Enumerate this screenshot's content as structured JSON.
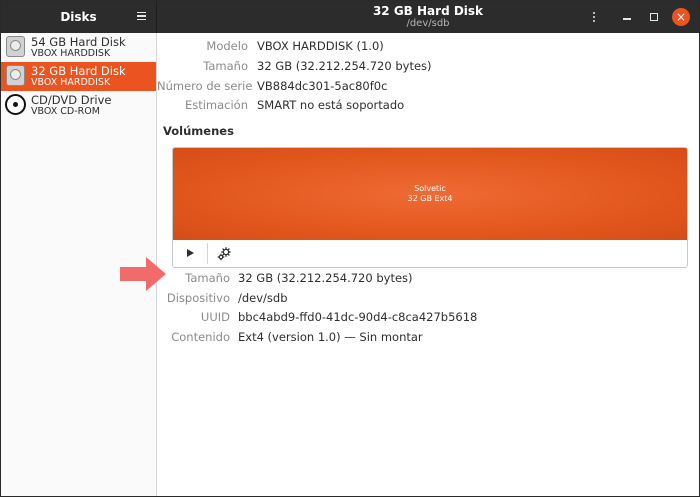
{
  "header": {
    "app_title": "Disks",
    "disk_title": "32 GB Hard Disk",
    "disk_path": "/dev/sdb",
    "close_glyph": "×"
  },
  "sidebar": {
    "drives": [
      {
        "name": "54 GB Hard Disk",
        "sub": "VBOX HARDDISK",
        "icon": "hard-disk-icon"
      },
      {
        "name": "32 GB Hard Disk",
        "sub": "VBOX HARDDISK",
        "icon": "hard-disk-icon",
        "selected": true
      },
      {
        "name": "CD/DVD Drive",
        "sub": "VBOX CD-ROM",
        "icon": "optical-drive-icon"
      }
    ]
  },
  "disk_info": {
    "model_label": "Modelo",
    "model": "VBOX HARDDISK (1.0)",
    "size_label": "Tamaño",
    "size": "32 GB (32.212.254.720 bytes)",
    "serial_label": "Número de serie",
    "serial": "VB884dc301-5ac80f0c",
    "assessment_label": "Estimación",
    "assessment": "SMART no está soportado"
  },
  "volumes": {
    "title": "Volúmenes",
    "partition_name": "Solvetic",
    "partition_info": "32 GB Ext4"
  },
  "volume_info": {
    "size_label": "Tamaño",
    "size": "32 GB (32.212.254.720 bytes)",
    "device_label": "Dispositivo",
    "device": "/dev/sdb",
    "uuid_label": "UUID",
    "uuid": "bbc4abd9-ffd0-41dc-90d4-c8ca427b5618",
    "contents_label": "Contenido",
    "contents": "Ext4 (version 1.0) — Sin montar"
  },
  "colors": {
    "accent": "#e95420",
    "headerbar": "#2c2c2c",
    "annotation_arrow": "#f26b6b"
  }
}
